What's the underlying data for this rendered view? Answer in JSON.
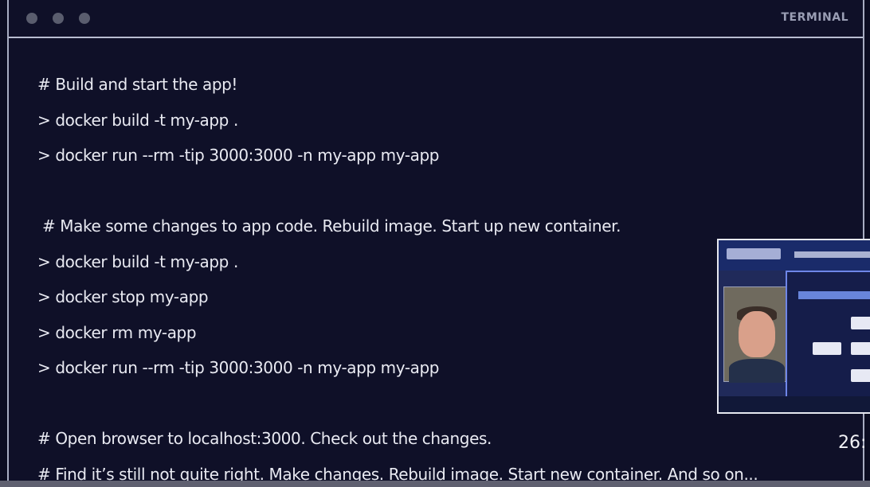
{
  "window": {
    "title": "TERMINAL",
    "controls": [
      "window-dot",
      "window-dot",
      "window-dot"
    ]
  },
  "terminal": {
    "lines": [
      "# Build and start the app!",
      "> docker build -t my-app .",
      "> docker run --rm -tip 3000:3000 -n my-app my-app",
      "",
      " # Make some changes to app code. Rebuild image. Start up new container.",
      "> docker build -t my-app .",
      "> docker stop my-app",
      "> docker rm my-app",
      "> docker run --rm -tip 3000:3000 -n my-app my-app",
      "",
      "# Open browser to localhost:3000. Check out the changes.",
      "# Find it’s still not quite right. Make changes. Rebuild image. Start new container. And so on..."
    ]
  },
  "video": {
    "timestamp": "26:",
    "thumbnail": "picture-in-picture-thumbnail"
  },
  "colors": {
    "background": "#0f1028",
    "text": "#e9eaf2",
    "border": "#b8bdd0"
  }
}
